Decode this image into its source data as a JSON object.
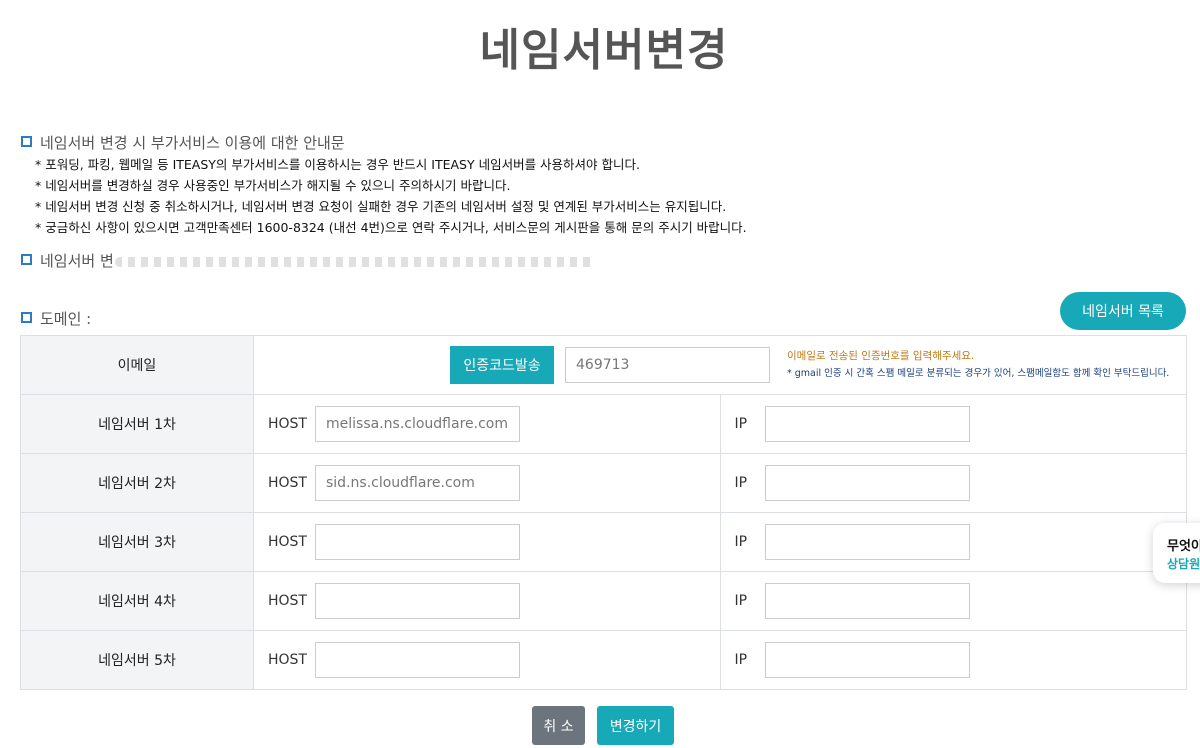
{
  "page": {
    "title": "네임서버변경"
  },
  "notice": {
    "title": "네임서버 변경 시 부가서비스 이용에 대한 안내문",
    "items": [
      "* 포워딩, 파킹, 웹메일 등 ITEASY의 부가서비스를 이용하시는 경우 반드시 ITEASY 네임서버를 사용하셔야 합니다.",
      "* 네임서버를 변경하실 경우 사용중인 부가서비스가 해지될 수 있으니 주의하시기 바랍니다.",
      "* 네임서버 변경 신청 중 취소하시거나, 네임서버 변경 요청이 실패한 경우 기존의 네임서버 설정 및 연계된 부가서비스는 유지됩니다.",
      "* 궁금하신 사항이 있으시면 고객만족센터 1600-8324 (내선 4번)으로 연락 주시거나, 서비스문의 게시판을 통해 문의 주시기 바랍니다."
    ],
    "second_title": "네임서버 변"
  },
  "domain": {
    "label": "도메인 :"
  },
  "buttons": {
    "ns_list": "네임서버 목록",
    "cancel": "취 소",
    "change": "변경하기"
  },
  "form": {
    "email_label": "이메일",
    "send_code_label": "인증코드발송",
    "code_value": "469713",
    "email_msg1": "이메일로 전송된 인증번호를 입력해주세요.",
    "email_msg2": "* gmail 인증 시 간혹 스팸 메일로 분류되는 경우가 있어, 스팸메일함도 함께 확인 부탁드립니다.",
    "host_label": "HOST",
    "ip_label": "IP",
    "nameservers": [
      {
        "label": "네임서버 1차",
        "host": "melissa.ns.cloudflare.com",
        "ip": ""
      },
      {
        "label": "네임서버 2차",
        "host": "sid.ns.cloudflare.com",
        "ip": ""
      },
      {
        "label": "네임서버 3차",
        "host": "",
        "ip": ""
      },
      {
        "label": "네임서버 4차",
        "host": "",
        "ip": ""
      },
      {
        "label": "네임서버 5차",
        "host": "",
        "ip": ""
      }
    ]
  },
  "chat": {
    "line1": "무엇이",
    "line2": "상담원"
  }
}
